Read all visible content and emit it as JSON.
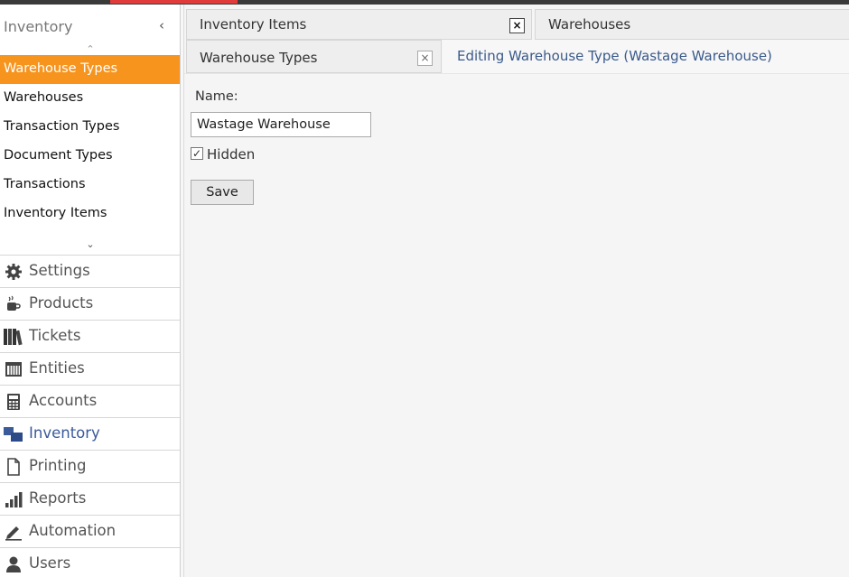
{
  "sidebar": {
    "title": "Inventory",
    "collapse_icon": "chevron-left-icon",
    "sub_items": [
      {
        "label": "Warehouse Types",
        "active": true
      },
      {
        "label": "Warehouses",
        "active": false
      },
      {
        "label": "Transaction Types",
        "active": false
      },
      {
        "label": "Document Types",
        "active": false
      },
      {
        "label": "Transactions",
        "active": false
      },
      {
        "label": "Inventory Items",
        "active": false
      }
    ],
    "nav_items": [
      {
        "label": "Settings",
        "icon": "gear-icon",
        "active": false
      },
      {
        "label": "Products",
        "icon": "coffee-cup-icon",
        "active": false
      },
      {
        "label": "Tickets",
        "icon": "books-icon",
        "active": false
      },
      {
        "label": "Entities",
        "icon": "table-icon",
        "active": false
      },
      {
        "label": "Accounts",
        "icon": "calculator-icon",
        "active": false
      },
      {
        "label": "Inventory",
        "icon": "inventory-icon",
        "active": true
      },
      {
        "label": "Printing",
        "icon": "document-icon",
        "active": false
      },
      {
        "label": "Reports",
        "icon": "bar-chart-icon",
        "active": false
      },
      {
        "label": "Automation",
        "icon": "pencil-icon",
        "active": false
      },
      {
        "label": "Users",
        "icon": "user-icon",
        "active": false
      }
    ]
  },
  "tabs": {
    "row1": [
      {
        "label": "Inventory Items",
        "closable": true
      },
      {
        "label": "Warehouses",
        "closable": false
      }
    ],
    "row2": [
      {
        "label": "Warehouse Types",
        "closable": true
      }
    ],
    "close_glyph": "×"
  },
  "editor": {
    "title": "Editing Warehouse Type (Wastage Warehouse)",
    "name_label": "Name:",
    "name_value": "Wastage Warehouse",
    "hidden_label": "Hidden",
    "hidden_checked": true,
    "check_glyph": "✓",
    "save_label": "Save"
  },
  "colors": {
    "active_item": "#f7941d",
    "active_nav_text": "#3a5a9a",
    "top_accent": "#e23b3b"
  }
}
